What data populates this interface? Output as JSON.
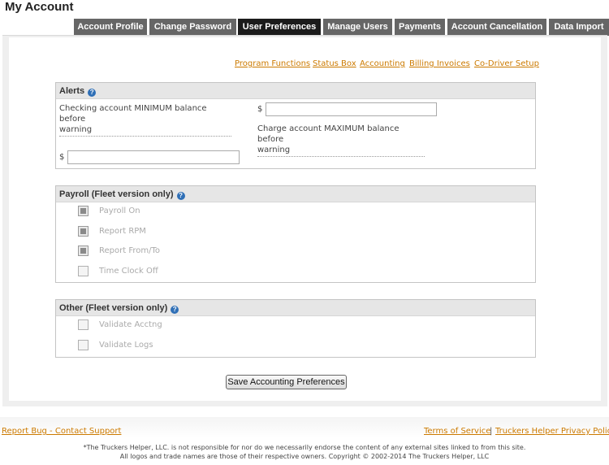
{
  "page": {
    "title": "My Account"
  },
  "tabs": [
    {
      "label": "Account Profile",
      "active": false
    },
    {
      "label": "Change Password",
      "active": false
    },
    {
      "label": "User Preferences",
      "active": true
    },
    {
      "label": "Manage Users",
      "active": false
    },
    {
      "label": "Payments",
      "active": false
    },
    {
      "label": "Account Cancellation",
      "active": false
    },
    {
      "label": "Data Import",
      "active": false
    }
  ],
  "sublinks": [
    "Program Functions",
    "Status Box",
    "Accounting",
    "Billing Invoices",
    "Co-Driver Setup"
  ],
  "alerts": {
    "title": "Alerts",
    "checking_label": "Checking account MINIMUM balance before warning",
    "checking_label_line1": "Checking account MINIMUM balance before",
    "checking_label_line2": "warning",
    "checking_currency": "$",
    "checking_value": "",
    "charge_label_line1": "Charge account MAXIMUM balance before",
    "charge_label_line2": "warning",
    "charge_currency": "$",
    "charge_value": ""
  },
  "payroll": {
    "title": "Payroll (Fleet version only)",
    "options": [
      {
        "label": "Payroll On",
        "checked": true
      },
      {
        "label": "Report RPM",
        "checked": true
      },
      {
        "label": "Report From/To",
        "checked": true
      },
      {
        "label": "Time Clock Off",
        "checked": false
      }
    ]
  },
  "other": {
    "title": "Other (Fleet version only)",
    "options": [
      {
        "label": "Validate Acctng",
        "checked": false
      },
      {
        "label": "Validate Logs",
        "checked": false
      }
    ]
  },
  "save_button": "Save Accounting Preferences",
  "footer": {
    "report_bug": "Report Bug - Contact Support",
    "terms": "Terms of Service",
    "separator": "|",
    "privacy": "Truckers Helper Privacy Policy",
    "disclaimer_line1": "*The Truckers Helper, LLC. is not responsible for nor do we necessarily endorse the content of any external sites linked to from this site.",
    "disclaimer_line2": "All logos and trade names are those of their respective owners. Copyright © 2002-2014 The Truckers Helper, LLC"
  },
  "icons": {
    "help": "help-icon",
    "checkbox": "checkbox"
  },
  "colors": {
    "link": "#cc7a00",
    "tab": "#666666",
    "tab_active": "#1b1b1b",
    "help": "#2f6fb6"
  }
}
